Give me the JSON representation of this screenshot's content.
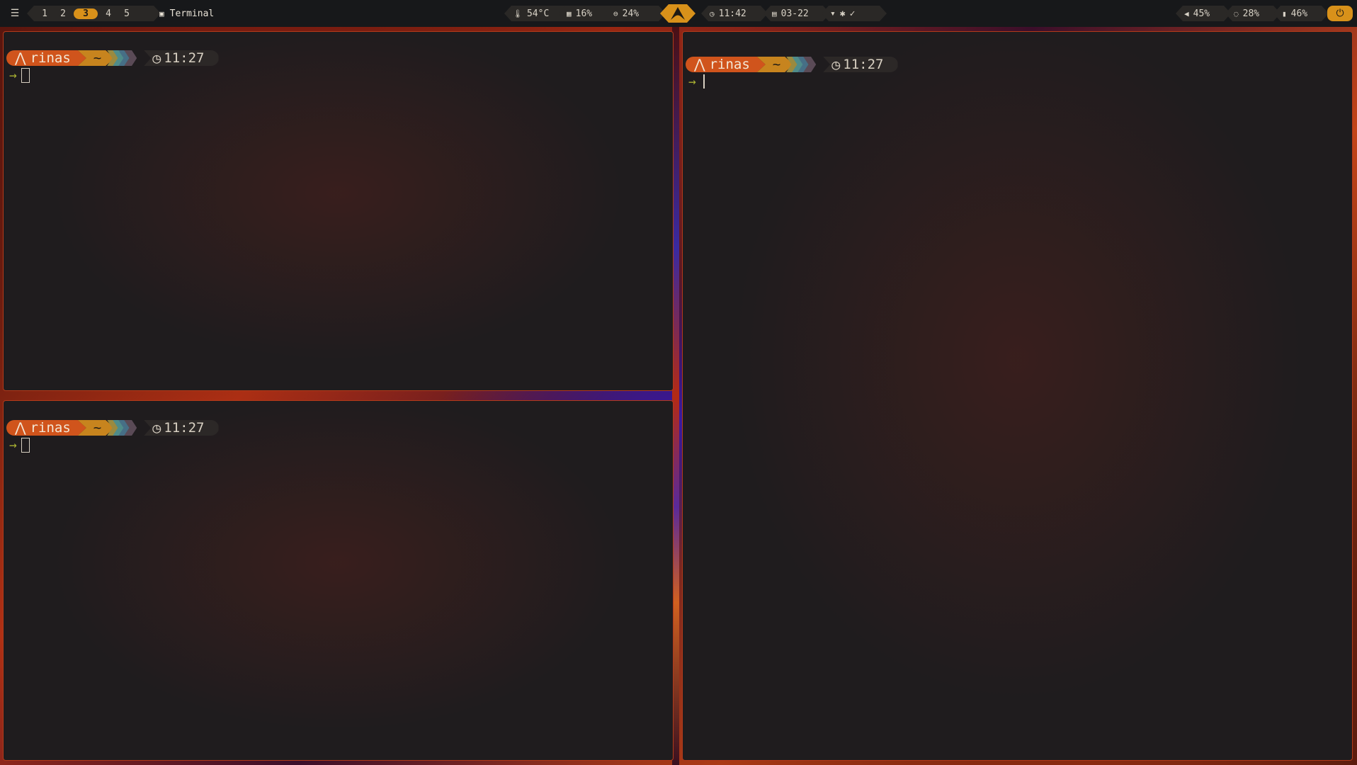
{
  "topbar": {
    "menu_icon": "hamburger-menu-icon",
    "workspaces": [
      "1",
      "2",
      "3",
      "4",
      "5"
    ],
    "active_workspace": "3",
    "window_title": "Terminal",
    "temperature": "54°C",
    "memory": "16%",
    "cpu": "24%",
    "time": "11:42",
    "date": "03-22",
    "volume": "45%",
    "brightness": "28%",
    "battery": "46%",
    "accent_color": "#d8911a"
  },
  "terminals": [
    {
      "user": "rinas",
      "dir": "~",
      "time": "11:27",
      "prompt_symbol": "→"
    },
    {
      "user": "rinas",
      "dir": "~",
      "time": "11:27",
      "prompt_symbol": "→"
    },
    {
      "user": "rinas",
      "dir": "~",
      "time": "11:27",
      "prompt_symbol": "→"
    }
  ],
  "colors": {
    "border": "#b23a1a",
    "segment_user": "#d0541c",
    "segment_dir": "#c7841e",
    "prompt_arrow": "#a9b132"
  }
}
